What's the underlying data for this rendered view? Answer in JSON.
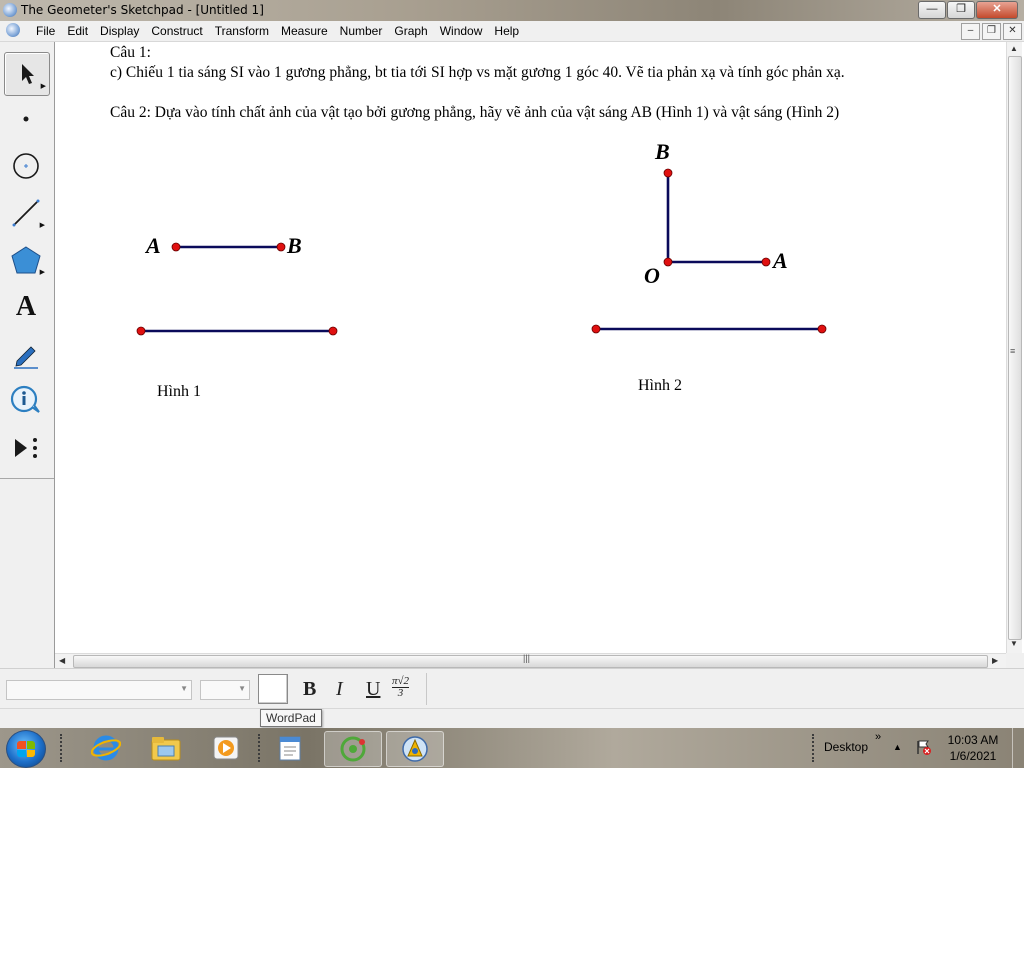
{
  "window": {
    "title": "The Geometer's Sketchpad - [Untitled 1]",
    "controls": {
      "minimize": "—",
      "maximize": "❐",
      "close": "✕"
    }
  },
  "menu": {
    "items": [
      "File",
      "Edit",
      "Display",
      "Construct",
      "Transform",
      "Measure",
      "Number",
      "Graph",
      "Window",
      "Help"
    ],
    "doc_controls": {
      "minimize": "‒",
      "restore": "❐",
      "close": "✕"
    }
  },
  "toolbox": {
    "tools": [
      "arrow-select-tool",
      "point-tool",
      "compass-tool",
      "straightedge-tool",
      "polygon-tool",
      "text-tool",
      "marker-tool",
      "information-tool",
      "custom-tools"
    ],
    "text_tool_glyph": "A"
  },
  "sketch": {
    "q1_title": "Câu 1:",
    "q1_text": "c) Chiếu 1 tia sáng SI vào 1 gương phẳng, bt tia tới SI hợp vs mặt gương 1 góc 40. Vẽ tia phản xạ và tính góc phản xạ.",
    "q2_text": "Câu 2: Dựa vào tính chất ảnh của vật tạo bởi gương phẳng, hãy vẽ ảnh của vật sáng AB (Hình 1) và vật sáng (Hình 2)",
    "fig1": {
      "label_a": "A",
      "label_b": "B",
      "caption": "Hình 1"
    },
    "fig2": {
      "label_b": "B",
      "label_o": "O",
      "label_a": "A",
      "caption": "Hình 2"
    },
    "colors": {
      "segment": "#0a0a5a",
      "point": "#e01010"
    }
  },
  "text_toolbar": {
    "font_value": "",
    "size_value": "",
    "bold": "B",
    "italic": "I",
    "underline": "U",
    "math_top": "π√2",
    "math_bottom": "3"
  },
  "tooltip": "WordPad",
  "taskbar": {
    "apps": [
      "internet-explorer",
      "windows-explorer",
      "media-player",
      "wordpad",
      "geogebra",
      "geometers-sketchpad"
    ],
    "tray_label": "Desktop",
    "chevron": "»",
    "time": "10:03 AM",
    "date": "1/6/2021"
  }
}
